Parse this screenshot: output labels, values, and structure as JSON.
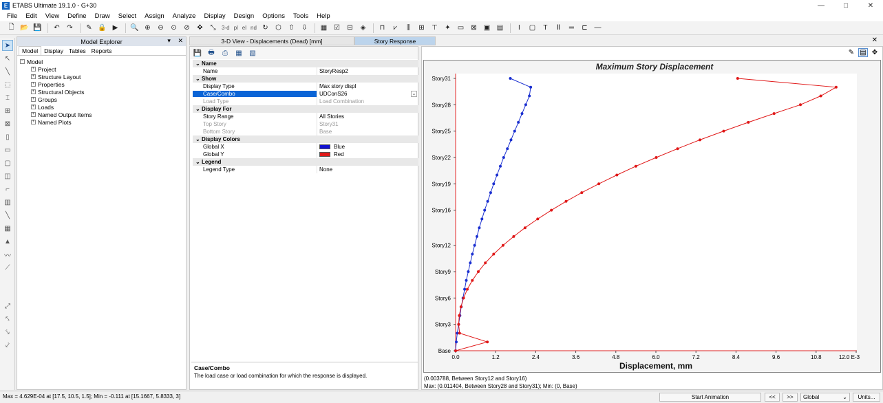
{
  "app": {
    "title": "ETABS Ultimate 19.1.0 - G+30",
    "icon": "E"
  },
  "window_controls": [
    "—",
    "□",
    "✕"
  ],
  "menu": [
    "File",
    "Edit",
    "View",
    "Define",
    "Draw",
    "Select",
    "Assign",
    "Analyze",
    "Display",
    "Design",
    "Options",
    "Tools",
    "Help"
  ],
  "toolbar_text": {
    "three_d": "3-d",
    "plan": "pl",
    "elev": "el",
    "nd": "nd"
  },
  "explorer": {
    "title": "Model Explorer",
    "tabs": [
      "Model",
      "Display",
      "Tables",
      "Reports"
    ],
    "root": "Model",
    "items": [
      "Project",
      "Structure Layout",
      "Properties",
      "Structural Objects",
      "Groups",
      "Loads",
      "Named Output Items",
      "Named Plots"
    ]
  },
  "doc_tabs": [
    {
      "label": "3-D View  - Displacements (Dead)  [mm]"
    },
    {
      "label": "Story Response"
    }
  ],
  "props": {
    "rows": [
      {
        "type": "cat",
        "k": "Name"
      },
      {
        "type": "row",
        "k": "Name",
        "v": "StoryResp2"
      },
      {
        "type": "cat",
        "k": "Show"
      },
      {
        "type": "row",
        "k": "Display Type",
        "v": "Max story displ"
      },
      {
        "type": "sel",
        "k": "Case/Combo",
        "v": "UDConS26"
      },
      {
        "type": "dis",
        "k": "Load Type",
        "v": "Load Combination"
      },
      {
        "type": "cat",
        "k": "Display For"
      },
      {
        "type": "row",
        "k": "Story Range",
        "v": "All Stories"
      },
      {
        "type": "dis",
        "k": "Top Story",
        "v": "Story31"
      },
      {
        "type": "dis",
        "k": "Bottom Story",
        "v": "Base"
      },
      {
        "type": "cat",
        "k": "Display Colors"
      },
      {
        "type": "color",
        "k": "Global X",
        "v": "Blue",
        "color": "#1010d0"
      },
      {
        "type": "color",
        "k": "Global Y",
        "v": "Red",
        "color": "#e01818"
      },
      {
        "type": "cat",
        "k": "Legend"
      },
      {
        "type": "row",
        "k": "Legend Type",
        "v": "None"
      }
    ],
    "description_title": "Case/Combo",
    "description_text": "The load case or load combination for which the response is displayed."
  },
  "chart_data": {
    "type": "line",
    "title": "Maximum Story Displacement",
    "xlabel": "Displacement, mm",
    "x_ticks": [
      "0.0",
      "1.2",
      "2.4",
      "3.6",
      "4.8",
      "6.0",
      "7.2",
      "8.4",
      "9.6",
      "10.8",
      "12.0 E-3"
    ],
    "xlim": [
      0,
      12.0
    ],
    "y_ticks": [
      "Story31",
      "Story28",
      "Story25",
      "Story22",
      "Story19",
      "Story16",
      "Story12",
      "Story9",
      "Story6",
      "Story3",
      "Base"
    ],
    "y_tick_levels": [
      31,
      28,
      25,
      22,
      19,
      16,
      12,
      9,
      6,
      3,
      0
    ],
    "ylim": [
      0,
      31
    ],
    "series": [
      {
        "name": "Global X",
        "color": "#1a2fd0",
        "x": [
          0,
          0.02,
          0.05,
          0.09,
          0.13,
          0.17,
          0.22,
          0.27,
          0.32,
          0.38,
          0.44,
          0.5,
          0.57,
          0.64,
          0.71,
          0.79,
          0.87,
          0.96,
          1.05,
          1.14,
          1.24,
          1.34,
          1.44,
          1.55,
          1.66,
          1.77,
          1.88,
          1.99,
          2.1,
          2.21,
          2.25,
          1.64
        ],
        "y": [
          0,
          1,
          2,
          3,
          4,
          5,
          6,
          7,
          8,
          9,
          10,
          11,
          12,
          13,
          14,
          15,
          16,
          17,
          18,
          19,
          20,
          21,
          22,
          23,
          24,
          25,
          26,
          27,
          28,
          29,
          30,
          31
        ]
      },
      {
        "name": "Global Y",
        "color": "#e01818",
        "x": [
          0,
          0.95,
          0.12,
          0.09,
          0.11,
          0.16,
          0.24,
          0.35,
          0.5,
          0.68,
          0.89,
          1.14,
          1.42,
          1.74,
          2.08,
          2.46,
          2.87,
          3.31,
          3.78,
          4.29,
          4.83,
          5.4,
          6.01,
          6.65,
          7.32,
          8.03,
          8.77,
          9.54,
          10.33,
          10.94,
          11.4,
          8.45
        ],
        "y": [
          0,
          1,
          2,
          3,
          4,
          5,
          6,
          7,
          8,
          9,
          10,
          11,
          12,
          13,
          14,
          15,
          16,
          17,
          18,
          19,
          20,
          21,
          22,
          23,
          24,
          25,
          26,
          27,
          28,
          29,
          30,
          31
        ]
      }
    ],
    "grid": false,
    "legend": "none"
  },
  "chart_status": {
    "line1": "(0.003788, Between Story12 and Story16)",
    "line2": "Max: (0.011404, Between Story28 and Story31);  Min: (0, Base)"
  },
  "statusbar": {
    "left": "Max = 4.629E-04 at [17.5, 10.5, 1.5];  Min = -0.111 at [15.1667, 5.8333, 3]",
    "start_animation": "Start Animation",
    "prev": "<<",
    "next": ">>",
    "coord_system": "Global",
    "units": "Units..."
  }
}
